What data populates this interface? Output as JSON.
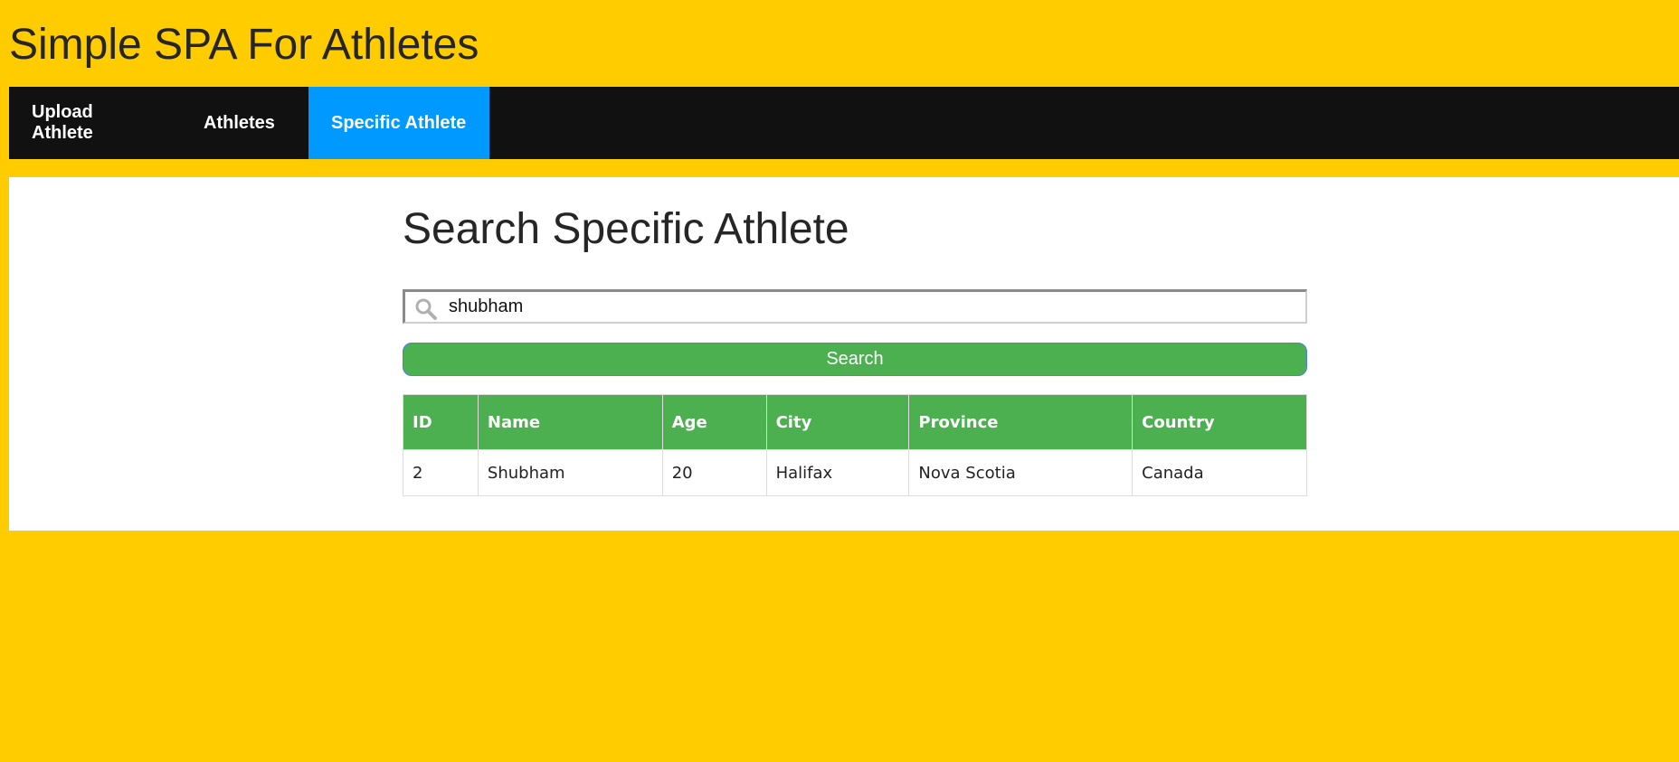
{
  "app": {
    "title": "Simple SPA For Athletes"
  },
  "nav": {
    "items": [
      {
        "label": "Upload Athlete",
        "active": false
      },
      {
        "label": "Athletes",
        "active": false
      },
      {
        "label": "Specific Athlete",
        "active": true
      }
    ]
  },
  "search": {
    "heading": "Search Specific Athlete",
    "value": "shubham",
    "button_label": "Search",
    "icon": "search-icon"
  },
  "table": {
    "columns": [
      "ID",
      "Name",
      "Age",
      "City",
      "Province",
      "Country"
    ],
    "rows": [
      [
        "2",
        "Shubham",
        "20",
        "Halifax",
        "Nova Scotia",
        "Canada"
      ]
    ]
  },
  "colors": {
    "background": "#ffcc00",
    "nav_background": "#111111",
    "nav_active": "#0099ff",
    "accent_green": "#4caf50"
  }
}
